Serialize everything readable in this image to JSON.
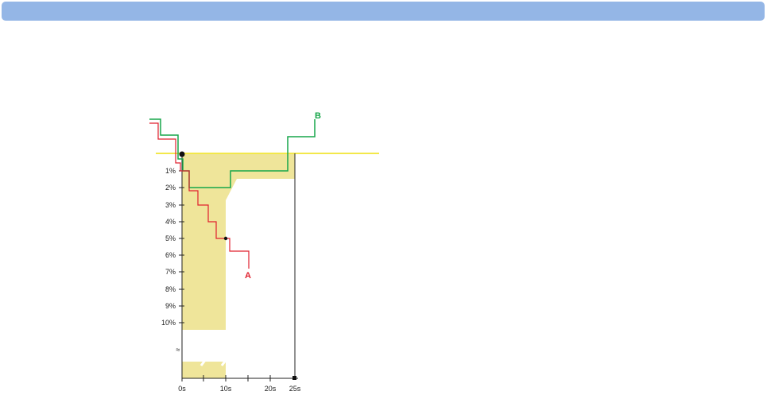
{
  "colors": {
    "header": "#94b6e6",
    "threshold_line": "#f3e84a",
    "shaded_area": "#efe59a",
    "curve_a": "#e0202e",
    "curve_b": "#17a64a"
  },
  "y_axis": {
    "ticks": [
      "1%",
      "2%",
      "3%",
      "4%",
      "5%",
      "6%",
      "7%",
      "8%",
      "9%",
      "10%"
    ],
    "break_symbol": "≈"
  },
  "x_axis": {
    "ticks": [
      "0s",
      "10s",
      "20s",
      "25s"
    ]
  },
  "curves": {
    "a_label": "A",
    "b_label": "B"
  }
}
